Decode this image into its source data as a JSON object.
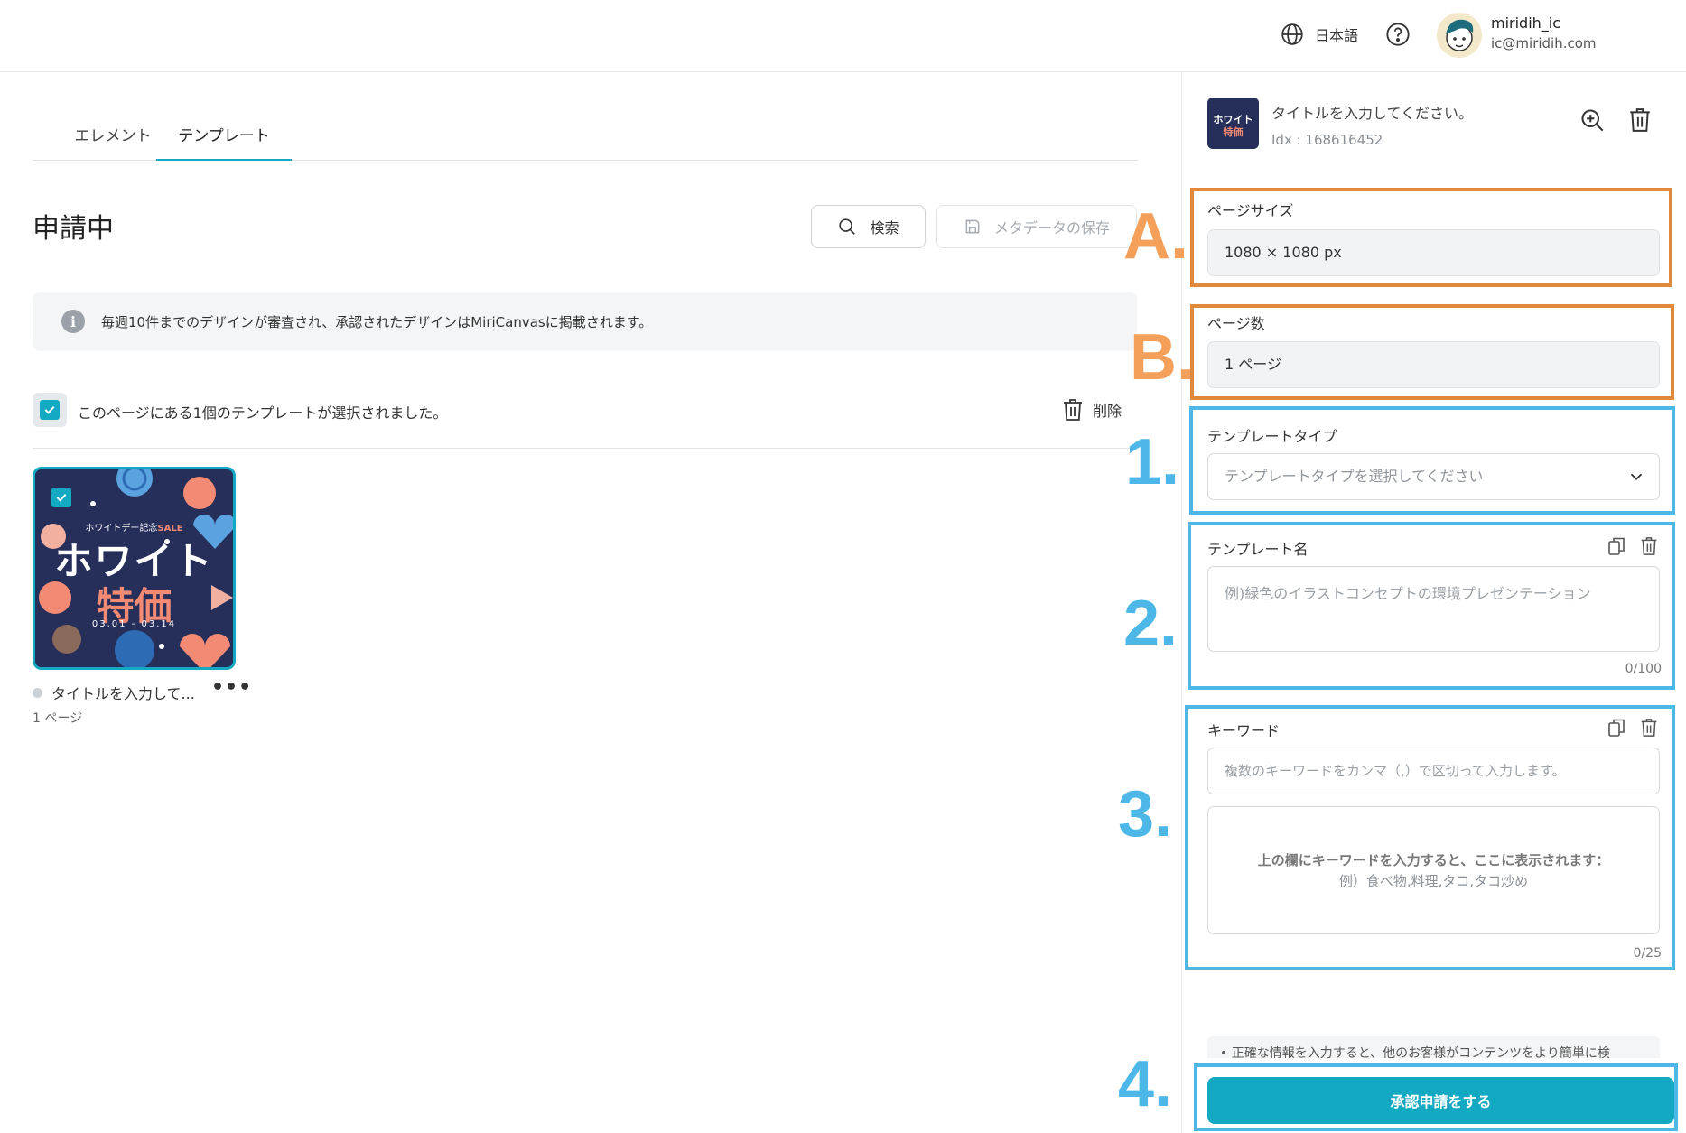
{
  "header": {
    "language": "日本語",
    "user_name": "miridih_ic",
    "user_email": "ic@miridih.com"
  },
  "tabs": [
    {
      "label": "エレメント",
      "active": false
    },
    {
      "label": "テンプレート",
      "active": true
    }
  ],
  "main": {
    "title": "申請中",
    "search_label": "検索",
    "save_meta_label": "メタデータの保存",
    "info_text": "毎週10件までのデザインが審査され、承認されたデザインはMiriCanvasに掲載されます。",
    "selection_text": "このページにある1個のテンプレートが選択されました。",
    "delete_label": "削除"
  },
  "template_card": {
    "subtitle_prefix": "ホワイトデー記念",
    "subtitle_accent": "SALE",
    "headline_1": "ホワイト",
    "headline_2": "特価",
    "date_range": "03.01 - 03.14",
    "caption": "タイトルを入力して...",
    "more": "•••",
    "pages": "1 ページ"
  },
  "details": {
    "title_placeholder": "タイトルを入力してください。",
    "idx": "Idx : 168616452",
    "page_size_label": "ページサイズ",
    "page_size_value": "1080 × 1080 px",
    "page_count_label": "ページ数",
    "page_count_value": "1 ページ",
    "template_type_label": "テンプレートタイプ",
    "template_type_placeholder": "テンプレートタイプを選択してください",
    "template_name_label": "テンプレート名",
    "template_name_placeholder": "例)緑色のイラストコンセプトの環境プレゼンテーション",
    "template_name_counter": "0/100",
    "keyword_label": "キーワード",
    "keyword_placeholder": "複数のキーワードをカンマ（,）で区切って入力します。",
    "keyword_hint_1": "上の欄にキーワードを入力すると、ここに表示されます：",
    "keyword_hint_2": "例）食べ物,料理,タコ,タコ炒め",
    "keyword_counter": "0/25",
    "notice_text": "• 正確な情報を入力すると、他のお客様がコンテンツをより簡単に検",
    "submit_label": "承認申請をする"
  },
  "annotations": {
    "A": "A.",
    "B": "B.",
    "n1": "1.",
    "n2": "2.",
    "n3": "3.",
    "n4": "4."
  },
  "colors": {
    "accent": "#14a9c2",
    "annotation_orange": "#e0893a",
    "annotation_blue": "#4db8e8"
  }
}
